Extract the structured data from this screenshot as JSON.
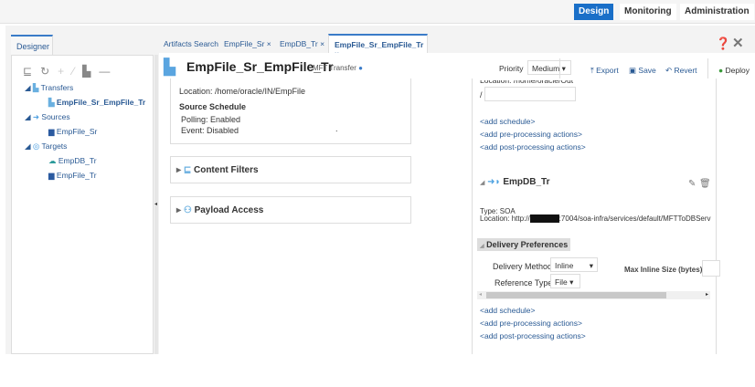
{
  "header": {
    "tabs": [
      {
        "label": "Design",
        "active": true
      },
      {
        "label": "Monitoring"
      },
      {
        "label": "Administration"
      }
    ],
    "accent": "#1a6fc8"
  },
  "designer": {
    "tab_label": "Designer",
    "toolbar_icons": [
      "filter-icon",
      "refresh-icon",
      "add-icon",
      "edit-icon",
      "copy-icon",
      "remove-icon"
    ],
    "tree": [
      {
        "label": "Transfers",
        "children": [
          "EmpFile_Sr_EmpFile_Tr"
        ]
      },
      {
        "label": "Sources",
        "children": [
          "EmpFile_Sr"
        ]
      },
      {
        "label": "Targets",
        "children": [
          "EmpDB_Tr",
          "EmpFile_Tr"
        ]
      }
    ]
  },
  "tabs": [
    {
      "label": "Artifacts Search"
    },
    {
      "label": "EmpFile_Sr",
      "closable": true
    },
    {
      "label": "EmpDB_Tr",
      "closable": true
    },
    {
      "label": "EmpFile_Sr_EmpFile_Tr",
      "closable": true,
      "active": true
    }
  ],
  "editor": {
    "title": "EmpFile_Sr_EmpFile_Tr",
    "subtitle": "MFT Transfer",
    "priority_label": "Priority",
    "priority_value": "Medium",
    "actions": {
      "export": "Export",
      "save": "Save",
      "revert": "Revert",
      "deploy": "Deploy"
    },
    "source": {
      "location": "Location: /home/oracle/IN/EmpFile",
      "schedule_title": "Source Schedule",
      "polling": "Polling: Enabled",
      "event": "Event: Disabled",
      "dot": "."
    },
    "sections": [
      "Content Filters",
      "Payload Access"
    ],
    "target_top": {
      "location": "Location: /home/oracle/Out",
      "path_value": "/",
      "links": [
        "<add schedule>",
        "<add pre-processing actions>",
        "<add post-processing actions>"
      ]
    },
    "target": {
      "name": "EmpDB_Tr",
      "type": "Type: SOA",
      "location_prefix": "Location: http://",
      "location_suffix": ":7004/soa-infra/services/default/MFTToDBServ",
      "delivery_title": "Delivery Preferences",
      "delivery_method_label": "Delivery Method",
      "delivery_method": "Inline",
      "max_inline_label": "Max Inline Size (bytes)",
      "reference_type_label": "Reference Type",
      "reference_type": "File",
      "links": [
        "<add schedule>",
        "<add pre-processing actions>",
        "<add post-processing actions>"
      ]
    }
  }
}
